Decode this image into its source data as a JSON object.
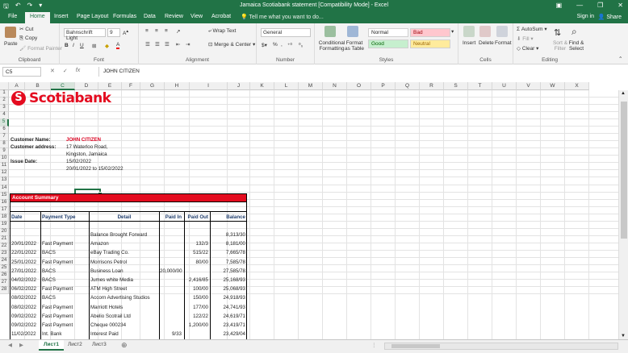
{
  "window": {
    "title": "Jamaica Scotiabank statement  [Compatibility Mode] - Excel",
    "sign_in": "Sign in",
    "share": "Share"
  },
  "tabs": [
    "File",
    "Home",
    "Insert",
    "Page Layout",
    "Formulas",
    "Data",
    "Review",
    "View",
    "Acrobat"
  ],
  "tell_me": "Tell me what you want to do...",
  "ribbon": {
    "clipboard": {
      "paste": "Paste",
      "cut": "Cut",
      "copy": "Copy",
      "format_painter": "Format Painter",
      "label": "Clipboard"
    },
    "font": {
      "name": "Bahnschrift Light",
      "size": "9",
      "label": "Font"
    },
    "alignment": {
      "wrap": "Wrap Text",
      "merge": "Merge & Center",
      "label": "Alignment"
    },
    "number": {
      "format": "General",
      "label": "Number"
    },
    "styles": {
      "conditional": "Conditional Formatting",
      "format_table": "Format as Table",
      "normal": "Normal",
      "bad": "Bad",
      "good": "Good",
      "neutral": "Neutral",
      "label": "Styles"
    },
    "cells": {
      "insert": "Insert",
      "delete": "Delete",
      "format": "Format",
      "label": "Cells"
    },
    "editing": {
      "autosum": "AutoSum",
      "fill": "Fill",
      "clear": "Clear",
      "sort": "Sort & Filter",
      "find": "Find & Select",
      "label": "Editing"
    }
  },
  "formula_bar": {
    "name_box": "C5",
    "formula": "JOHN CITIZEN"
  },
  "columns": [
    "A",
    "B",
    "C",
    "D",
    "E",
    "F",
    "G",
    "H",
    "I",
    "J",
    "K",
    "L",
    "M",
    "N",
    "O",
    "P",
    "Q",
    "R",
    "S",
    "T",
    "U",
    "V",
    "W",
    "X"
  ],
  "rows": [
    "1",
    "2",
    "3",
    "4",
    "5",
    "6",
    "7",
    "8",
    "9",
    "10",
    "11",
    "12",
    "13",
    "14",
    "15",
    "16",
    "17",
    "18",
    "19",
    "20",
    "21",
    "22",
    "23",
    "24",
    "25",
    "26",
    "27",
    "28"
  ],
  "logo_text": "Scotiabank",
  "customer": {
    "name_label": "Customer Name:",
    "name": "JOHN CITIZEN",
    "address_label": "Customer address:",
    "address1": "17 Waterloo Road,",
    "address2": "Kingston, Jamaica",
    "issue_label": "Issue Date:",
    "issue_date": "15/02/2022",
    "period": "20/01/2022 to 15/02/2022"
  },
  "summary_title": "Account Summary",
  "table_headers": [
    "Date",
    "Payment Type",
    "Detail",
    "Paid In",
    "Paid Out",
    "Balance"
  ],
  "transactions": [
    {
      "date": "",
      "type": "",
      "detail": "Balance Brought Forward",
      "in": "",
      "out": "",
      "balance": "8,313/30"
    },
    {
      "date": "20/01/2022",
      "type": "Fast Payment",
      "detail": "Amazon",
      "in": "",
      "out": "132/3",
      "balance": "8,181/00"
    },
    {
      "date": "22/01/2022",
      "type": "BACS",
      "detail": "eBay Trading Co.",
      "in": "",
      "out": "515/22",
      "balance": "7,665/78"
    },
    {
      "date": "25/01/2022",
      "type": "Fast Payment",
      "detail": "Morrisons Petrol",
      "in": "",
      "out": "80/00",
      "balance": "7,585/78"
    },
    {
      "date": "27/01/2022",
      "type": "BACS",
      "detail": "Business Loan",
      "in": "20,000/00",
      "out": "",
      "balance": "27,585/78"
    },
    {
      "date": "04/02/2022",
      "type": "BACS",
      "detail": "Jumes white Media",
      "in": "",
      "out": "2,416/85",
      "balance": "25,168/93"
    },
    {
      "date": "06/02/2022",
      "type": "Fast Payment",
      "detail": "ATM High Street",
      "in": "",
      "out": "100/00",
      "balance": "25,068/93"
    },
    {
      "date": "08/02/2022",
      "type": "BACS",
      "detail": "Accorn Advertising Studios",
      "in": "",
      "out": "150/00",
      "balance": "24,918/93"
    },
    {
      "date": "08/02/2022",
      "type": "Fast Payment",
      "detail": "Marriott Hotels",
      "in": "",
      "out": "177/00",
      "balance": "24,741/93"
    },
    {
      "date": "09/02/2022",
      "type": "Fast Payment",
      "detail": "Abelio Scotrail Ltd",
      "in": "",
      "out": "122/22",
      "balance": "24,619/71"
    },
    {
      "date": "09/02/2022",
      "type": "Fast Payment",
      "detail": "Cheque 000234",
      "in": "",
      "out": "1,200/00",
      "balance": "23,419/71"
    },
    {
      "date": "11/02/2022",
      "type": "Int. Bank",
      "detail": "Interest Paid",
      "in": "9/33",
      "out": "",
      "balance": "23,429/04"
    }
  ],
  "sheets": [
    "Лист1",
    "Лист2",
    "Лист3"
  ]
}
